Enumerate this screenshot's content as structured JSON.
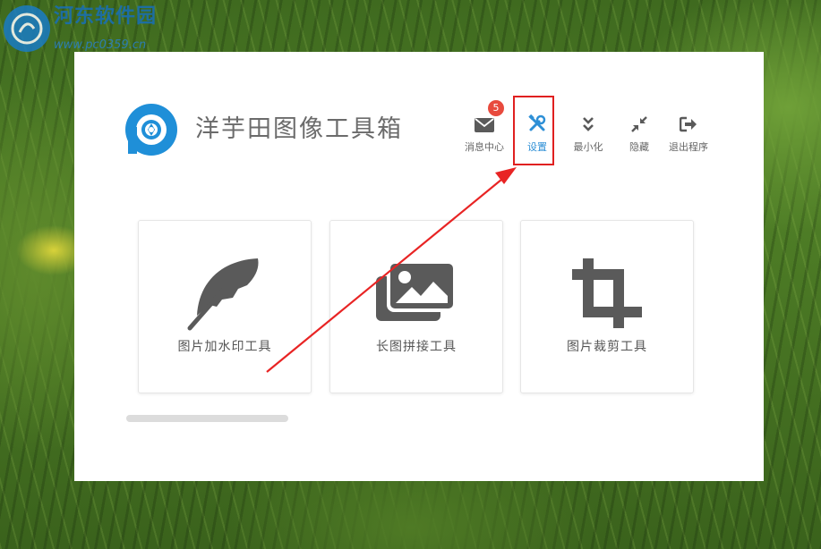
{
  "watermark": {
    "title": "河东软件园",
    "url": "www.pc0359.cn"
  },
  "app": {
    "title": "洋芋田图像工具箱"
  },
  "toolbar": {
    "messages": {
      "label": "消息中心",
      "badge": "5"
    },
    "settings": {
      "label": "设置"
    },
    "minimize": {
      "label": "最小化"
    },
    "hide": {
      "label": "隐藏"
    },
    "exit": {
      "label": "退出程序"
    }
  },
  "tools": [
    {
      "label": "图片加水印工具",
      "icon": "feather-icon"
    },
    {
      "label": "长图拼接工具",
      "icon": "images-icon"
    },
    {
      "label": "图片裁剪工具",
      "icon": "crop-icon"
    }
  ],
  "colors": {
    "accent": "#2d8fd6",
    "badge": "#e84a3d",
    "highlight": "#e02020",
    "icon": "#5a5a5a"
  }
}
